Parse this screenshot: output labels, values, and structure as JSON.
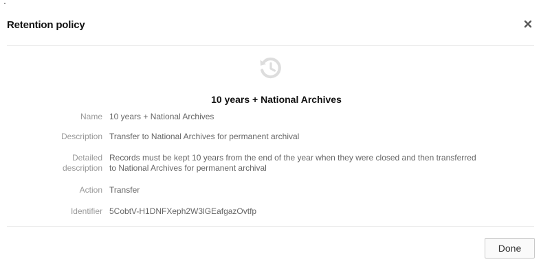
{
  "dialog": {
    "title": "Retention policy",
    "close_icon": "close-icon",
    "policy_icon": "history-icon",
    "heading": "10 years + National Archives",
    "details": [
      {
        "label": "Name",
        "value": "10 years + National Archives"
      },
      {
        "label": "Description",
        "value": "Transfer to National Archives for permanent archival"
      },
      {
        "label_line1": "Detailed",
        "label_line2": "description",
        "value_line1": "Records must be kept 10 years from the end of the year when they were closed and then transferred",
        "value_line2": "to National Archives for permanent archival"
      },
      {
        "label": "Action",
        "value": "Transfer"
      },
      {
        "label": "Identifier",
        "value": "5CobtV-H1DNFXeph2W3lGEafgazOvtfp"
      }
    ],
    "done_label": "Done"
  },
  "colors": {
    "label": "#9a9a9a",
    "value": "#666666",
    "icon": "#dddddd",
    "divider": "#ececec"
  }
}
